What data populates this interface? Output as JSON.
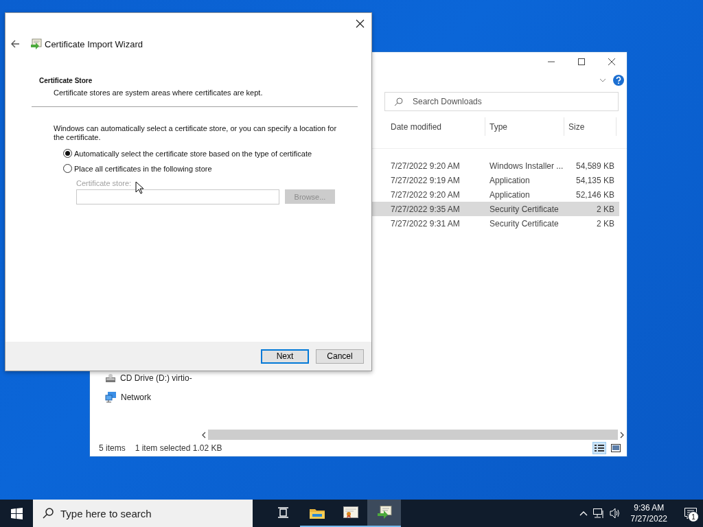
{
  "explorer": {
    "search": {
      "placeholder": "Search Downloads"
    },
    "columns": [
      "Date modified",
      "Type",
      "Size"
    ],
    "rows": [
      {
        "date": "7/27/2022 9:20 AM",
        "type": "Windows Installer ...",
        "size": "54,589 KB",
        "selected": false
      },
      {
        "date": "7/27/2022 9:19 AM",
        "type": "Application",
        "size": "54,135 KB",
        "selected": false
      },
      {
        "date": "7/27/2022 9:20 AM",
        "type": "Application",
        "size": "52,146 KB",
        "selected": false
      },
      {
        "date": "7/27/2022 9:35 AM",
        "type": "Security Certificate",
        "size": "2 KB",
        "selected": true
      },
      {
        "date": "7/27/2022 9:31 AM",
        "type": "Security Certificate",
        "size": "2 KB",
        "selected": false
      }
    ],
    "nav": [
      {
        "label": "CD Drive (D:) virtio-",
        "kind": "drive"
      },
      {
        "label": "Network",
        "kind": "network"
      }
    ],
    "status": {
      "count": "5 items",
      "selection": "1 item selected",
      "size": "1.02 KB"
    }
  },
  "wizard": {
    "title": "Certificate Import Wizard",
    "heading": "Certificate Store",
    "description": "Certificate stores are system areas where certificates are kept.",
    "body": "Windows can automatically select a certificate store, or you can specify a location for the certificate.",
    "options": [
      {
        "label": "Automatically select the certificate store based on the type of certificate",
        "selected": true
      },
      {
        "label": "Place all certificates in the following store",
        "selected": false
      }
    ],
    "store_label": "Certificate store:",
    "browse": {
      "label": "Browse...",
      "disabled": true
    },
    "buttons": [
      {
        "label": "Next",
        "default": true
      },
      {
        "label": "Cancel",
        "default": false
      }
    ]
  },
  "taskbar": {
    "search": {
      "placeholder": "Type here to search"
    },
    "apps": [
      {
        "kind": "taskview",
        "active": false
      },
      {
        "kind": "folder",
        "active": false
      },
      {
        "kind": "certificate",
        "active": false
      },
      {
        "kind": "wizard",
        "active": true
      }
    ],
    "time": "9:36 AM",
    "date": "7/27/2022",
    "notifications": "1"
  }
}
